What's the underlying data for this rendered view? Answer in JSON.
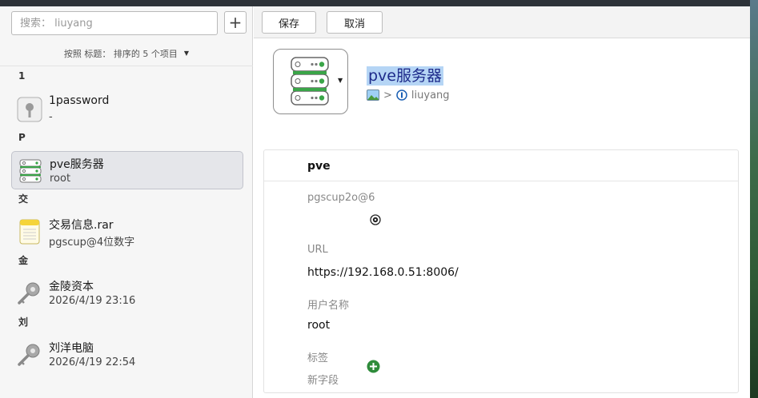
{
  "search": {
    "placeholder": "搜索： liuyang",
    "value": ""
  },
  "add_label": "+",
  "sort_bar": {
    "label": "按照 标题： 排序的 5 个项目"
  },
  "sections": [
    {
      "letter": "1",
      "items": [
        {
          "title": "1password",
          "subtitle": "-",
          "icon": "key-icon"
        }
      ]
    },
    {
      "letter": "P",
      "items": [
        {
          "title": "pve服务器",
          "subtitle": "root",
          "icon": "server-icon",
          "selected": true
        }
      ]
    },
    {
      "letter": "交",
      "items": [
        {
          "title": "交易信息.rar",
          "subtitle": "pgscup@4位数字",
          "icon": "note-icon"
        }
      ]
    },
    {
      "letter": "金",
      "items": [
        {
          "title": "金陵资本",
          "subtitle": "2026/4/19 23:16",
          "icon": "key-icon"
        }
      ]
    },
    {
      "letter": "刘",
      "items": [
        {
          "title": "刘洋电脑",
          "subtitle": "2026/4/19 22:54",
          "icon": "key-icon"
        }
      ]
    }
  ],
  "toolbar": {
    "save_label": "保存",
    "cancel_label": "取消"
  },
  "detail": {
    "title": "pve服务器",
    "breadcrumb": {
      "separator": ">",
      "vault": "liuyang"
    },
    "section_title": "pve",
    "fields": [
      {
        "label": "pgscup2o@6",
        "value": ""
      },
      {
        "label": "URL",
        "value": "https://192.168.0.51:8006/"
      },
      {
        "label": "用户名称",
        "value": "root"
      }
    ],
    "tags_label": "标签",
    "new_field_label": "新字段"
  },
  "colors": {
    "selection_bg": "#e5e6ea",
    "title_highlight": "#b5d5f5",
    "add_green": "#2e8b3a"
  }
}
